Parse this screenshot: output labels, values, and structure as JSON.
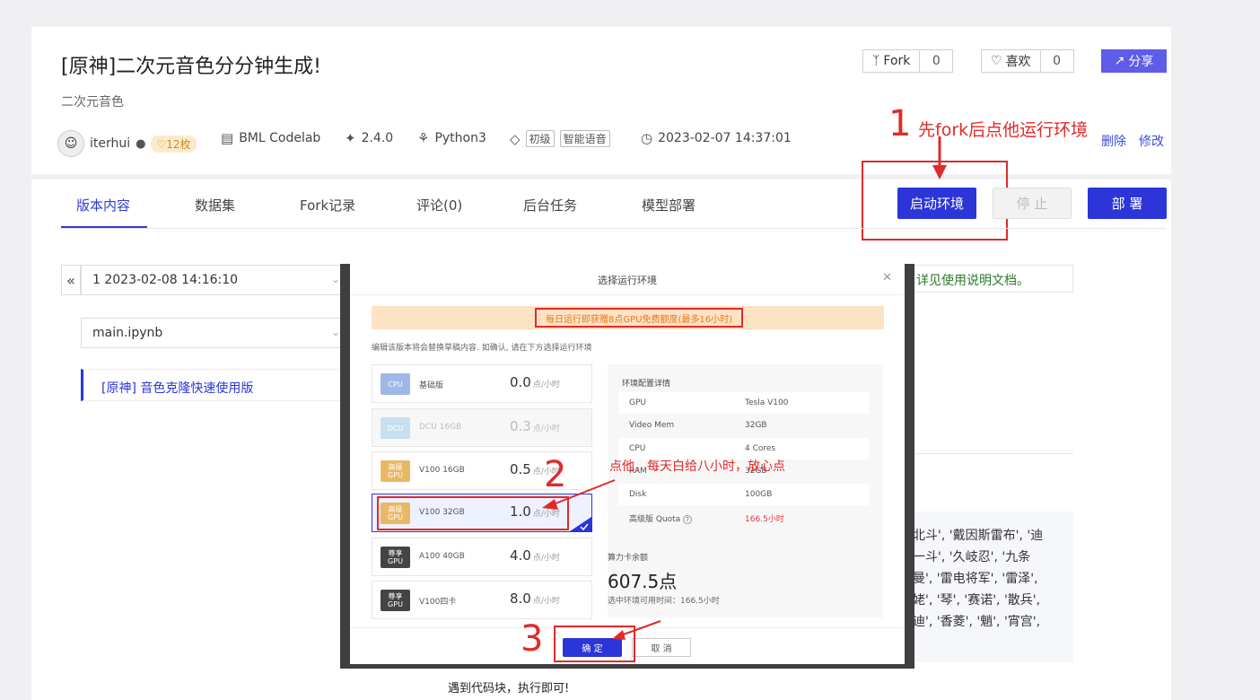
{
  "header": {
    "title": "[原神]二次元音色分分钟生成!",
    "subtitle": "二次元音色",
    "author": "iterhui",
    "badge": "12枚",
    "platform": "BML Codelab",
    "version": "2.4.0",
    "language": "Python3",
    "tags": [
      "初级",
      "智能语音"
    ],
    "timestamp": "2023-02-07 14:37:01",
    "fork_label": "Fork",
    "fork_count": "0",
    "like_label": "喜欢",
    "like_count": "0",
    "share_label": "分享",
    "delete_label": "删除",
    "edit_label": "修改"
  },
  "tabs": [
    "版本内容",
    "数据集",
    "Fork记录",
    "评论(0)",
    "后台任务",
    "模型部署"
  ],
  "actions": {
    "start_label": "启动环境",
    "stop_label": "停 止",
    "deploy_label": "部 署"
  },
  "left_panel": {
    "version_select": "1 2023-02-08 14:16:10",
    "file_select": "main.ipynb",
    "toc_item": "[原神] 音色克隆快速使用版"
  },
  "right_panel": {
    "doc_note": "详见使用说明文档。",
    "text_lines": [
      "北斗', '戴因斯雷布', '迪",
      "一斗', '久岐忍', '九条",
      "曼', '雷电将军', '雷泽',",
      "姥', '琴', '赛诺', '散兵',",
      "迪', '香菱', '魈', '宵宫',"
    ]
  },
  "footer_text": "遇到代码块，执行即可!",
  "dialog": {
    "title": "选择运行环境",
    "banner": "每日运行即获赠8点GPU免费额度(最多16小时)",
    "note": "编辑该版本将会替换草稿内容. 如确认, 请在下方选择运行环境",
    "unit": "点/小时",
    "envs": [
      {
        "icon": "CPU",
        "name": "基础版",
        "price": "0.0",
        "color": "#9fb8e8"
      },
      {
        "icon": "DCU",
        "name": "DCU 16GB",
        "price": "0.3",
        "color": "#c7e0f0"
      },
      {
        "icon": "高级 GPU",
        "name": "V100 16GB",
        "price": "0.5",
        "color": "#e8b865"
      },
      {
        "icon": "高级 GPU",
        "name": "V100 32GB",
        "price": "1.0",
        "color": "#e8b865"
      },
      {
        "icon": "尊享 GPU",
        "name": "A100 40GB",
        "price": "4.0",
        "color": "#444444"
      },
      {
        "icon": "尊享 GPU",
        "name": "V100四卡",
        "price": "8.0",
        "color": "#444444"
      }
    ],
    "config_title": "环境配置详情",
    "config": [
      {
        "k": "GPU",
        "v": "Tesla V100"
      },
      {
        "k": "Video Mem",
        "v": "32GB"
      },
      {
        "k": "CPU",
        "v": "4 Cores"
      },
      {
        "k": "RAM",
        "v": "32GB"
      },
      {
        "k": "Disk",
        "v": "100GB"
      },
      {
        "k": "高级版 Quota",
        "v": "166.5小时"
      }
    ],
    "balance_label": "算力卡余额",
    "balance_value": "607.5点",
    "available_time": "选中环境可用时间：166.5小时",
    "confirm_label": "确 定",
    "cancel_label": "取 消"
  },
  "annotations": {
    "step1_num": "1",
    "step1_text": "先fork后点他运行环境",
    "step2_num": "2",
    "step2_text": "点他，每天白给八小时，放心点",
    "step3_num": "3"
  },
  "colors": {
    "primary": "#2b35d8",
    "share": "#5e5ce8",
    "annotation_red": "#e02a2a",
    "quota_red": "#e0383e"
  }
}
